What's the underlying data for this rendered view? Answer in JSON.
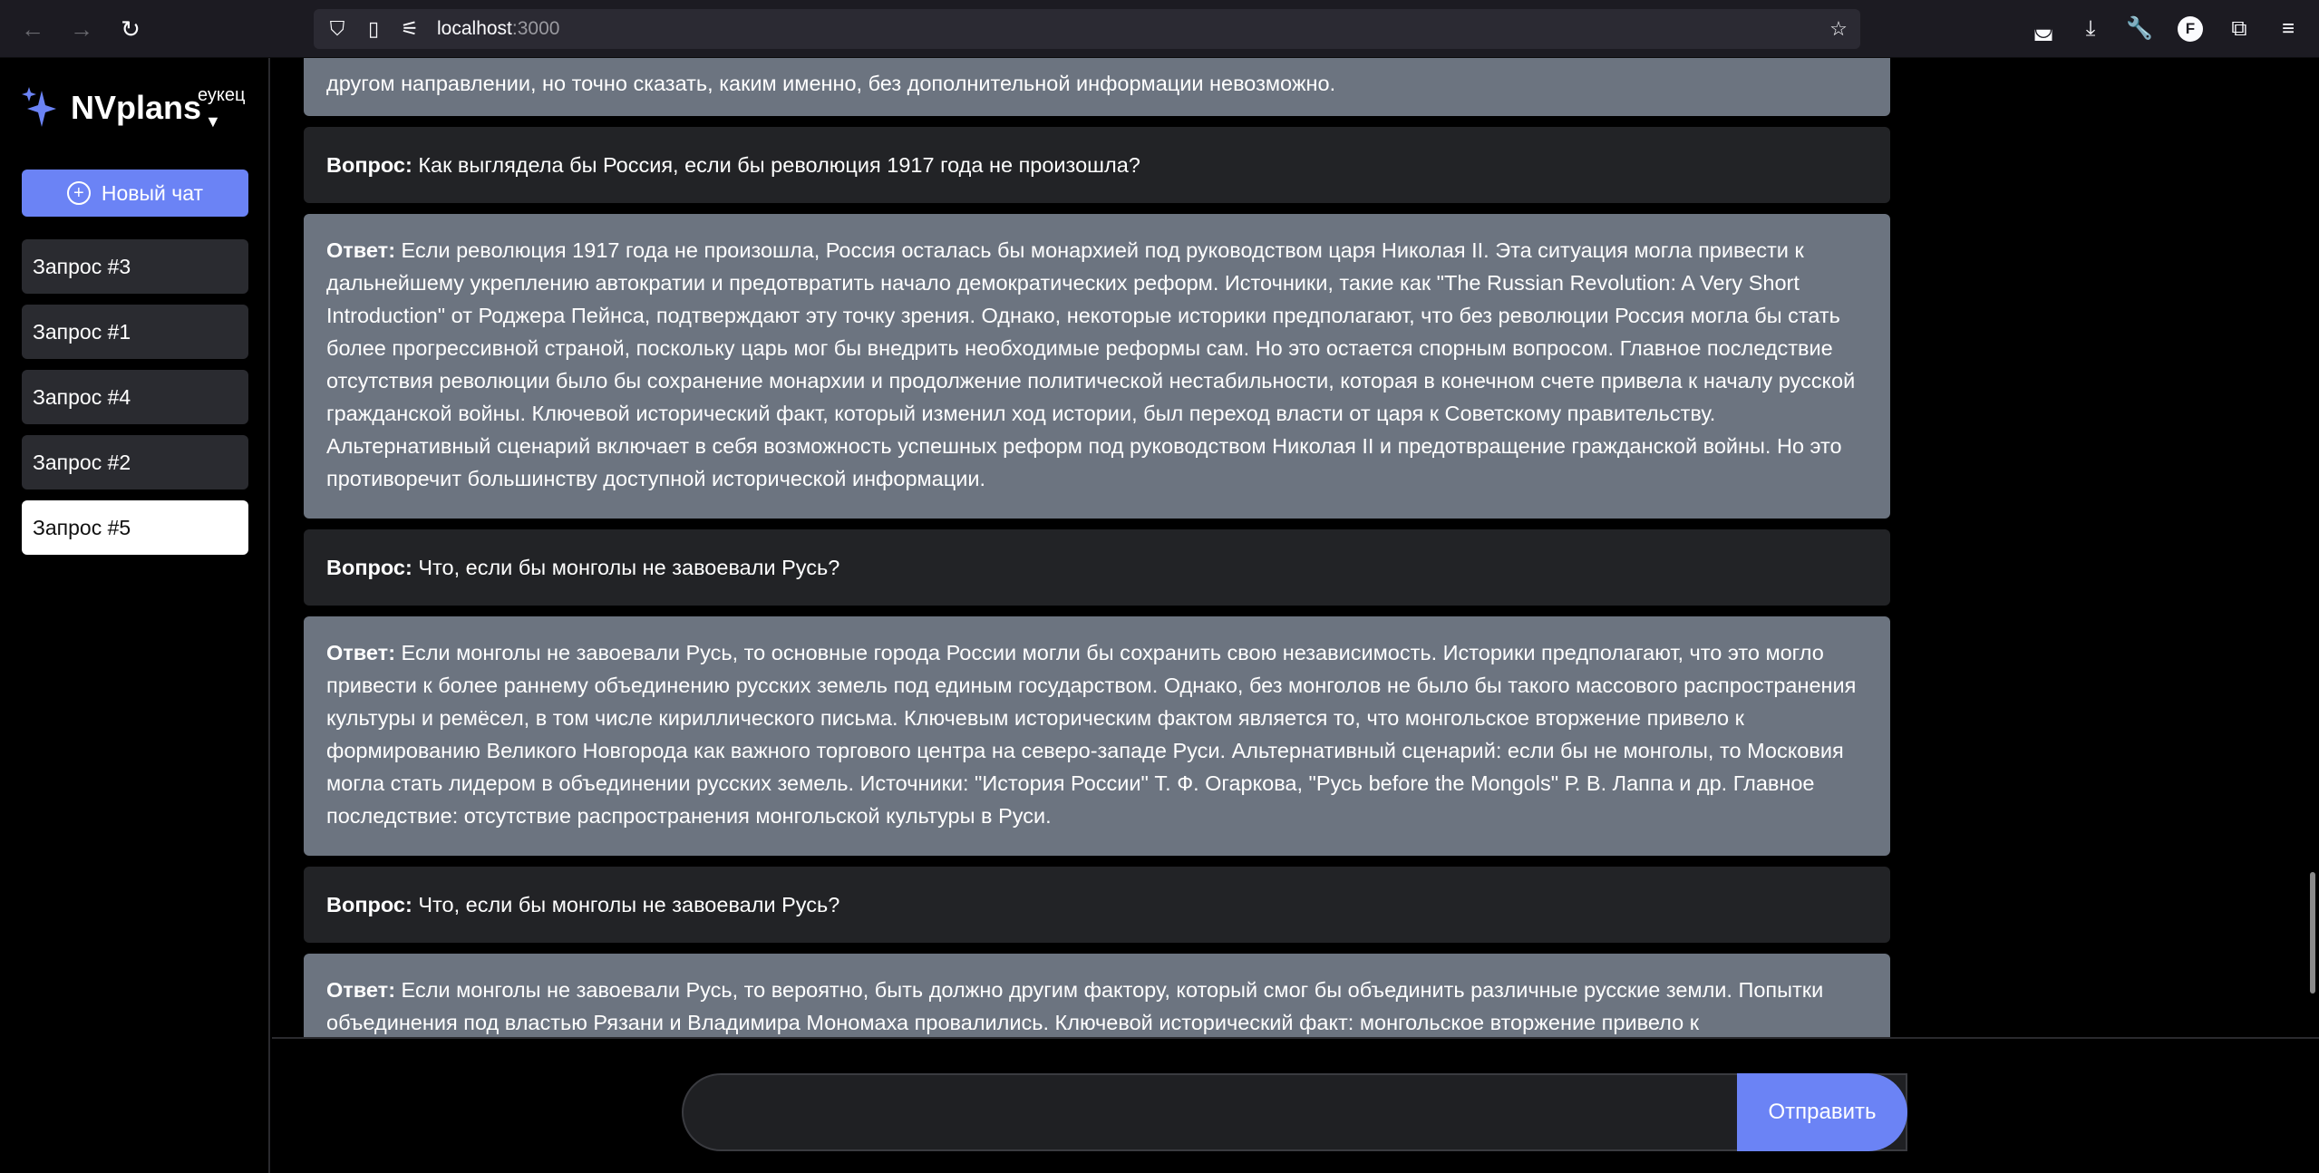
{
  "browser": {
    "url_host": "localhost",
    "url_port": ":3000",
    "profile_initial": "F"
  },
  "sidebar": {
    "logo_text": "NVplans",
    "username": "еукец",
    "new_chat_label": "Новый чат",
    "requests": [
      {
        "label": "Запрос #3",
        "active": false
      },
      {
        "label": "Запрос #1",
        "active": false
      },
      {
        "label": "Запрос #4",
        "active": false
      },
      {
        "label": "Запрос #2",
        "active": false
      },
      {
        "label": "Запрос #5",
        "active": true
      }
    ]
  },
  "messages": [
    {
      "kind": "answer",
      "prefix": "",
      "text": "другом направлении, но точно сказать, каким именно, без дополнительной информации невозможно."
    },
    {
      "kind": "question",
      "prefix": "Вопрос:",
      "text": " Как выглядела бы Россия, если бы революция 1917 года не произошла?"
    },
    {
      "kind": "answer",
      "prefix": "Ответ:",
      "text": " Если революция 1917 года не произошла, Россия осталась бы монархией под руководством царя Николая II. Эта ситуация могла привести к дальнейшему укреплению автократии и предотвратить начало демократических реформ. Источники, такие как \"The Russian Revolution: A Very Short Introduction\" от Роджера Пейнса, подтверждают эту точку зрения. Однако, некоторые историки предполагают, что без революции Россия могла бы стать более прогрессивной страной, поскольку царь мог бы внедрить необходимые реформы сам. Но это остается спорным вопросом. Главное последствие отсутствия революции было бы сохранение монархии и продолжение политической нестабильности, которая в конечном счете привела к началу русской гражданской войны. Ключевой исторический факт, который изменил ход истории, был переход власти от царя к Советскому правительству. Альтернативный сценарий включает в себя возможность успешных реформ под руководством Николая II и предотвращение гражданской войны. Но это противоречит большинству доступной исторической информации."
    },
    {
      "kind": "question",
      "prefix": "Вопрос:",
      "text": " Что, если бы монголы не завоевали Русь?"
    },
    {
      "kind": "answer",
      "prefix": "Ответ:",
      "text": " Если монголы не завоевали Русь, то основные города России могли бы сохранить свою независимость. Историки предполагают, что это могло привести к более раннему объединению русских земель под единым государством. Однако, без монголов не было бы такого массового распространения культуры и ремёсел, в том числе кириллического письма. Ключевым историческим фактом является то, что монгольское вторжение привело к формированию Великого Новгорода как важного торгового центра на северо-западе Руси. Альтернативный сценарий: если бы не монголы, то Московия могла стать лидером в объединении русских земель. Источники: \"История России\" Т. Ф. Огаркова, \"Русь before the Mongols\" Р. В. Лаппа и др. Главное последствие: отсутствие распространения монгольской культуры в Руси."
    },
    {
      "kind": "question",
      "prefix": "Вопрос:",
      "text": " Что, если бы монголы не завоевали Русь?"
    },
    {
      "kind": "answer",
      "prefix": "Ответ:",
      "text": " Если монголы не завоевали Русь, то вероятно, быть должно другим фактору, который смог бы объединить различные русские земли. Попытки объединения под властью Рязани и Владимира Мономаха провалились. Ключевой исторический факт: монгольское вторжение привело к"
    }
  ],
  "composer": {
    "placeholder": "",
    "send_label": "Отправить"
  },
  "colors": {
    "accent": "#6b83f5",
    "question_bg": "#222326",
    "answer_bg": "#6c7480"
  }
}
